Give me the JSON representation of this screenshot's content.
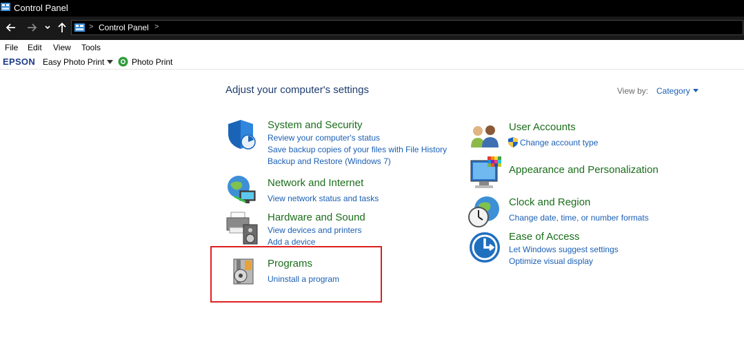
{
  "window": {
    "title": "Control Panel"
  },
  "address": {
    "crumbs": [
      "Control Panel"
    ],
    "separator": ">"
  },
  "menu": [
    "File",
    "Edit",
    "View",
    "Tools"
  ],
  "toolbar": {
    "brand": "EPSON",
    "app1": "Easy Photo Print",
    "app2": "Photo Print"
  },
  "main": {
    "heading": "Adjust your computer's settings",
    "view_by_label": "View by:",
    "view_by_value": "Category",
    "left": [
      {
        "title": "System and Security",
        "links": [
          "Review your computer's status",
          "Save backup copies of your files with File History",
          "Backup and Restore (Windows 7)"
        ]
      },
      {
        "title": "Network and Internet",
        "links": [
          "View network status and tasks"
        ]
      },
      {
        "title": "Hardware and Sound",
        "links": [
          "View devices and printers",
          "Add a device"
        ]
      },
      {
        "title": "Programs",
        "links": [
          "Uninstall a program"
        ]
      }
    ],
    "right": [
      {
        "title": "User Accounts",
        "links": [
          "Change account type"
        ]
      },
      {
        "title": "Appearance and Personalization",
        "links": []
      },
      {
        "title": "Clock and Region",
        "links": [
          "Change date, time, or number formats"
        ]
      },
      {
        "title": "Ease of Access",
        "links": [
          "Let Windows suggest settings",
          "Optimize visual display"
        ]
      }
    ]
  },
  "colors": {
    "title_green": "#1b6d1b",
    "link_blue": "#1a5fb4",
    "heading_blue": "#1e3c6e",
    "highlight_red": "#e01e1e"
  }
}
